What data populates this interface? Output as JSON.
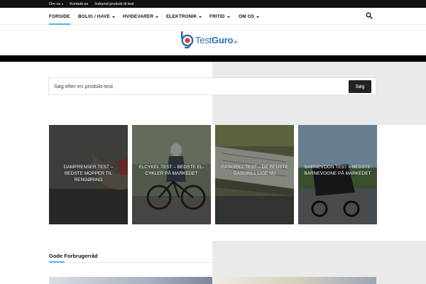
{
  "topbar": {
    "items": [
      {
        "label": "Om os",
        "has_caret": true
      },
      {
        "label": "Kontakt os",
        "has_caret": false
      },
      {
        "label": "Indsend produkt til test",
        "has_caret": false
      }
    ]
  },
  "nav": {
    "items": [
      {
        "label": "FORSIDE",
        "active": true,
        "has_caret": false
      },
      {
        "label": "BOLIG / HAVE",
        "active": false,
        "has_caret": true
      },
      {
        "label": "HVIDEVARER",
        "active": false,
        "has_caret": true
      },
      {
        "label": "ELEKTRONIK",
        "active": false,
        "has_caret": true
      },
      {
        "label": "FRITID",
        "active": false,
        "has_caret": true
      },
      {
        "label": "OM OS",
        "active": false,
        "has_caret": true
      }
    ],
    "search_icon": "search-icon"
  },
  "logo": {
    "text_regular": "Test",
    "text_bold": "Guro",
    "text_suffix": ".dk"
  },
  "search": {
    "placeholder": "Søg efter en produkt-test",
    "button_label": "Søg"
  },
  "tiles": [
    {
      "title": "DAMPRENSER TEST – BEDSTE MOPPER TIL RENGØRING"
    },
    {
      "title": "ELCYKEL TEST – BEDSTE EL-CYKLER PÅ MARKEDET"
    },
    {
      "title": "GASGRILL TEST – DE BEDSTE GASGRILL LIGE NU"
    },
    {
      "title": "BARNEVOGN TEST – BEDSTE BARNEVOGNE PÅ MARKEDET"
    }
  ],
  "section": {
    "title": "Gode Forbrugerråd"
  },
  "colors": {
    "accent": "#4db2ec",
    "logo_blue": "#2a6db0",
    "topbar_bg": "#111111"
  }
}
